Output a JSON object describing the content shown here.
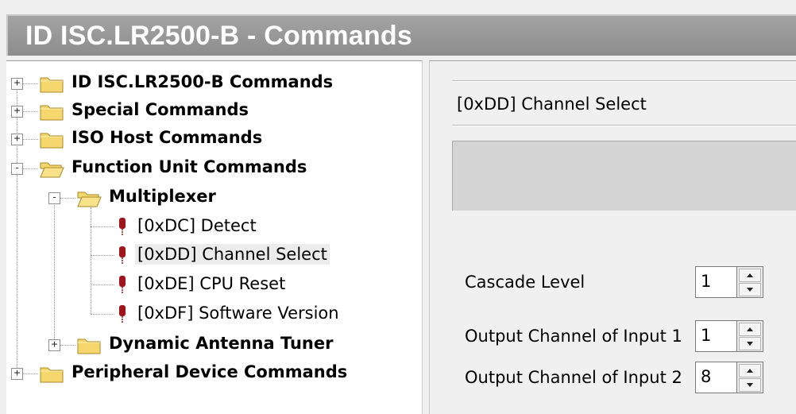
{
  "window": {
    "title": "ID ISC.LR2500-B - Commands"
  },
  "tree": {
    "items": [
      {
        "label": "ID ISC.LR2500-B Commands",
        "expander": "+"
      },
      {
        "label": "Special Commands",
        "expander": "+"
      },
      {
        "label": "ISO Host Commands",
        "expander": "+"
      },
      {
        "label": "Function Unit Commands",
        "expander": "-"
      },
      {
        "label": "Multiplexer",
        "expander": "-"
      },
      {
        "label": "[0xDC] Detect"
      },
      {
        "label": "[0xDD] Channel Select"
      },
      {
        "label": "[0xDE] CPU Reset"
      },
      {
        "label": "[0xDF] Software Version"
      },
      {
        "label": "Dynamic Antenna Tuner",
        "expander": "+"
      },
      {
        "label": "Peripheral Device Commands",
        "expander": "+"
      }
    ]
  },
  "detail": {
    "command_title": "[0xDD] Channel Select",
    "fields": [
      {
        "label": "Cascade Level",
        "value": "1"
      },
      {
        "label": "Output Channel of Input 1",
        "value": "1"
      },
      {
        "label": "Output Channel of Input 2",
        "value": "8"
      }
    ]
  },
  "colors": {
    "title_bar": "#999999",
    "folder": "#f5d76e",
    "command_icon": "#a0141c",
    "selection": "#ececec"
  },
  "icons": {
    "folder": "folder-icon",
    "folder_open": "folder-open-icon",
    "command": "command-icon",
    "spin_up": "spin-up-icon",
    "spin_down": "spin-down-icon"
  }
}
